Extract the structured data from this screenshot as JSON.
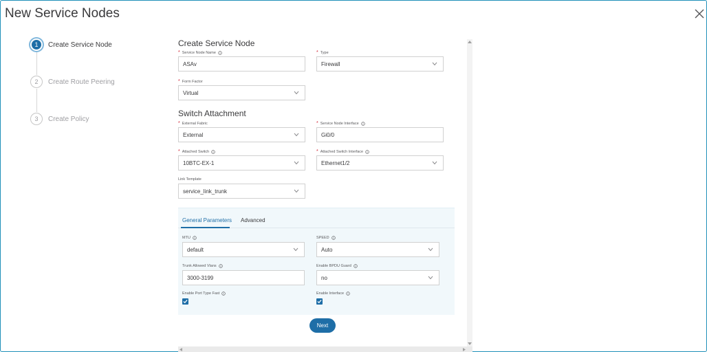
{
  "window": {
    "title": "New Service Nodes"
  },
  "steps": [
    {
      "number": "1",
      "label": "Create Service Node",
      "active": true
    },
    {
      "number": "2",
      "label": "Create Route Peering",
      "active": false
    },
    {
      "number": "3",
      "label": "Create Policy",
      "active": false
    }
  ],
  "create_service_node": {
    "heading": "Create Service Node",
    "service_node_name": {
      "label": "Service Node Name",
      "value": "ASAv"
    },
    "type": {
      "label": "Type",
      "value": "Firewall"
    },
    "form_factor": {
      "label": "Form Factor",
      "value": "Virtual"
    }
  },
  "switch_attachment": {
    "heading": "Switch Attachment",
    "external_fabric": {
      "label": "External Fabric",
      "value": "External"
    },
    "service_node_interface": {
      "label": "Service Node Interface",
      "value": "Gi0/0"
    },
    "attached_switch": {
      "label": "Attached Switch",
      "value": "10BTC-EX-1"
    },
    "attached_switch_interface": {
      "label": "Attached Switch Interface",
      "value": "Ethernet1/2"
    },
    "link_template": {
      "label": "Link Template",
      "value": "service_link_trunk"
    }
  },
  "tabs": [
    {
      "label": "General Parameters",
      "active": true
    },
    {
      "label": "Advanced",
      "active": false
    }
  ],
  "general_params": {
    "mtu": {
      "label": "MTU",
      "value": "default"
    },
    "speed": {
      "label": "SPEED",
      "value": "Auto"
    },
    "trunk_allowed_vlans": {
      "label": "Trunk Allowed Vlans",
      "value": "3000-3199"
    },
    "enable_bpdu_guard": {
      "label": "Enable BPDU Guard",
      "value": "no"
    },
    "enable_port_type_fast": {
      "label": "Enable Port Type Fast",
      "checked": true
    },
    "enable_interface": {
      "label": "Enable Interface",
      "checked": true
    }
  },
  "actions": {
    "next_label": "Next"
  },
  "colors": {
    "accent": "#1e6ea7",
    "required": "#cf2030",
    "panel_bg": "#f1f8fb",
    "frame_border": "#1e8fb8"
  }
}
